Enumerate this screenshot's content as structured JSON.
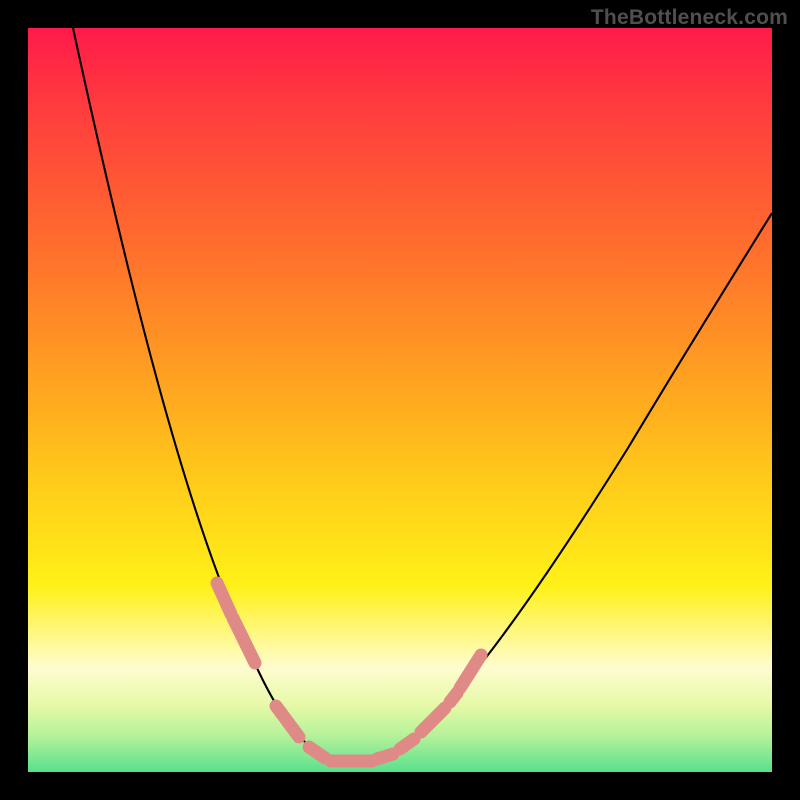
{
  "watermark": "TheBottleneck.com",
  "chart_data": {
    "type": "line",
    "title": "",
    "xlabel": "",
    "ylabel": "",
    "xlim": [
      0,
      100
    ],
    "ylim": [
      0,
      100
    ],
    "grid": false,
    "legend": false,
    "series": [
      {
        "name": "bottleneck-curve",
        "x": [
          6,
          10,
          14,
          18,
          22,
          25,
          28,
          30,
          32,
          34,
          36,
          38,
          40,
          42,
          44,
          46,
          48,
          52,
          56,
          60,
          66,
          74,
          82,
          90,
          100
        ],
        "y": [
          100,
          88,
          76,
          64,
          52,
          42,
          33,
          27,
          21,
          16,
          11,
          7,
          4,
          2,
          1,
          1,
          2,
          6,
          12,
          20,
          32,
          48,
          60,
          70,
          80
        ]
      }
    ],
    "markers": [
      {
        "name": "dot-segment",
        "x_range": [
          25.5,
          28.0
        ],
        "band": "upper"
      },
      {
        "name": "dot-segment",
        "x_range": [
          27.5,
          31.5
        ],
        "band": "mid"
      },
      {
        "name": "dot-segment",
        "x_range": [
          34.0,
          38.0
        ],
        "band": "lower"
      },
      {
        "name": "dot-segment",
        "x_range": [
          38.5,
          41.0
        ],
        "band": "bottom"
      },
      {
        "name": "dot-segment",
        "x_range": [
          41.5,
          46.5
        ],
        "band": "bottom"
      },
      {
        "name": "dot-segment",
        "x_range": [
          47.0,
          49.5
        ],
        "band": "bottom"
      },
      {
        "name": "dot-segment",
        "x_range": [
          50.5,
          52.5
        ],
        "band": "lower"
      },
      {
        "name": "dot-segment",
        "x_range": [
          53.5,
          57.0
        ],
        "band": "mid"
      },
      {
        "name": "dot-segment",
        "x_range": [
          57.5,
          58.5
        ],
        "band": "upper"
      },
      {
        "name": "dot-segment",
        "x_range": [
          58.0,
          61.5
        ],
        "band": "upper"
      }
    ],
    "gradient_stops": [
      {
        "pos": 0.0,
        "color": "#ff1a4a"
      },
      {
        "pos": 0.1,
        "color": "#ff3a3f"
      },
      {
        "pos": 0.28,
        "color": "#ff6a2e"
      },
      {
        "pos": 0.45,
        "color": "#ff9b22"
      },
      {
        "pos": 0.6,
        "color": "#ffc81a"
      },
      {
        "pos": 0.75,
        "color": "#fff118"
      },
      {
        "pos": 0.86,
        "color": "#fffccf"
      },
      {
        "pos": 0.91,
        "color": "#e6f9a8"
      },
      {
        "pos": 0.95,
        "color": "#b7f29a"
      },
      {
        "pos": 1.0,
        "color": "#59e08c"
      }
    ],
    "marker_color": "#e08a87",
    "curve_color": "#000000"
  }
}
